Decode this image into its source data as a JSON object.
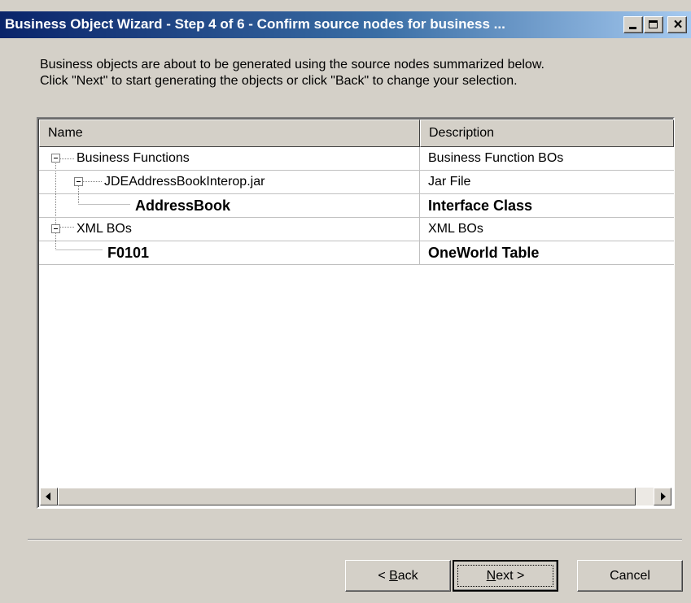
{
  "window": {
    "title": "Business Object Wizard - Step 4 of 6 - Confirm source nodes for business ..."
  },
  "intro": {
    "line1": "Business objects are about to be generated using the source nodes summarized below.",
    "line2": "Click \"Next\" to start generating the objects or click \"Back\" to change your selection."
  },
  "table": {
    "columns": [
      "Name",
      "Description"
    ],
    "rows": [
      {
        "name": "Business Functions",
        "description": "Business Function BOs",
        "level": 0,
        "expandable": true,
        "bold": false
      },
      {
        "name": "JDEAddressBookInterop.jar",
        "description": "Jar File",
        "level": 1,
        "expandable": true,
        "bold": false
      },
      {
        "name": "AddressBook",
        "description": "Interface Class",
        "level": 2,
        "expandable": false,
        "bold": true
      },
      {
        "name": "XML BOs",
        "description": "XML BOs",
        "level": 0,
        "expandable": true,
        "bold": false
      },
      {
        "name": "F0101",
        "description": "OneWorld Table",
        "level": 1,
        "expandable": false,
        "bold": true
      }
    ]
  },
  "buttons": {
    "back": {
      "prefix": "< ",
      "mnemonic": "B",
      "rest": "ack"
    },
    "next": {
      "mnemonic": "N",
      "rest": "ext >"
    },
    "cancel": "Cancel"
  },
  "colors": {
    "titlebar_start": "#0a246a",
    "titlebar_end": "#a6caf0",
    "face": "#d4d0c8"
  }
}
